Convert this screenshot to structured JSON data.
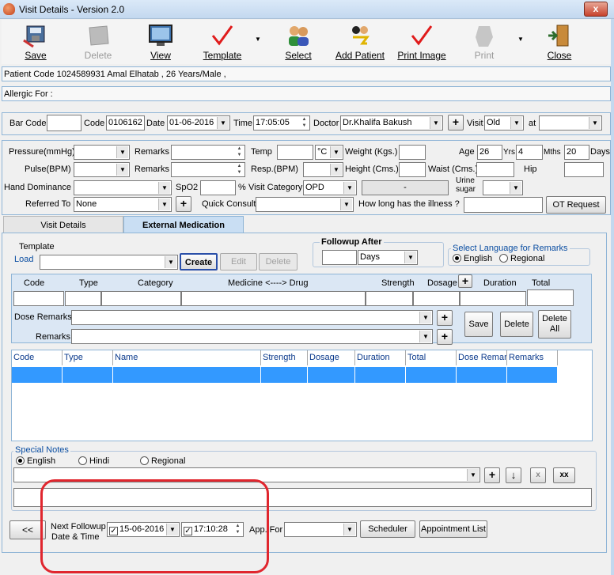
{
  "window": {
    "title": "Visit Details - Version 2.0",
    "close_glyph": "x"
  },
  "toolbar": {
    "save": "Save",
    "delete": "Delete",
    "view": "View",
    "template": "Template",
    "select": "Select",
    "add_patient": "Add Patient",
    "print_image": "Print Image",
    "print": "Print",
    "close": "Close"
  },
  "patient_info": "Patient Code 1024589931 Amal Elhatab , 26 Years/Male      ,",
  "allergic_for": "Allergic For :",
  "visit_bar": {
    "bar_code_label": "Bar Code",
    "bar_code": "",
    "code_label": "Code",
    "code": "0106162",
    "date_label": "Date",
    "date": "01-06-2016",
    "time_label": "Time",
    "time": "17:05:05",
    "doctor_label": "Doctor",
    "doctor": "Dr.Khalifa Bakush",
    "visit_label": "Visit",
    "visit": "Old",
    "at_label": "at",
    "at": ""
  },
  "vitals": {
    "pressure_label": "Pressure(mmHg)",
    "pulse_label": "Pulse(BPM)",
    "remarks_label": "Remarks",
    "temp_label": "Temp",
    "temp_unit": "°C",
    "resp_label": "Resp.(BPM)",
    "weight_label": "Weight (Kgs.)",
    "height_label": "Height (Cms.)",
    "age_label": "Age",
    "age_years": "26",
    "yrs_label": "Yrs",
    "age_months": "4",
    "mths_label": "Mths",
    "age_days": "20",
    "days_label": "Days",
    "waist_label": "Waist (Cms.)",
    "hip_label": "Hip",
    "hand_label": "Hand Dominance",
    "spo2_label": "SpO2",
    "percent": "%",
    "visit_category_label": "Visit Category",
    "visit_category": "OPD",
    "dash": "-",
    "urine_label": "Urine sugar",
    "referred_label": "Referred To",
    "referred": "None",
    "quick_consult_label": "Quick Consult",
    "illness_label": "How long has the illness ?",
    "ot_request": "OT Request"
  },
  "tabs": {
    "visit_details": "Visit Details",
    "external_medication": "External Medication"
  },
  "template": {
    "group": "Template",
    "load": "Load",
    "create": "Create",
    "edit": "Edit",
    "delete": "Delete"
  },
  "followup": {
    "group": "Followup After",
    "value": "",
    "unit": "Days"
  },
  "language": {
    "group": "Select Language for Remarks",
    "english": "English",
    "regional": "Regional"
  },
  "medicine": {
    "headers": [
      "Code",
      "Type",
      "Category",
      "Medicine <----> Drug",
      "Strength",
      "Dosage",
      "Duration",
      "Total"
    ],
    "dose_remarks": "Dose Remarks",
    "remarks": "Remarks",
    "save": "Save",
    "delete": "Delete",
    "delete_all": "Delete All"
  },
  "grid": {
    "headers": [
      "Code",
      "Type",
      "Name",
      "Strength",
      "Dosage",
      "Duration",
      "Total",
      "Dose Remar",
      "Remarks"
    ]
  },
  "notes": {
    "group": "Special Notes",
    "english": "English",
    "hindi": "Hindi",
    "regional": "Regional",
    "x": "x",
    "xx": "xx"
  },
  "bottom": {
    "back": "<<",
    "next_followup": "Next Followup",
    "date_time": "Date & Time",
    "date": "15-06-2016",
    "time": "17:10:28",
    "app_for": "App. For",
    "scheduler": "Scheduler",
    "appointment_list": "Appointment List"
  },
  "colors": {
    "accent": "#3399ff",
    "annotation": "#e0262e"
  }
}
